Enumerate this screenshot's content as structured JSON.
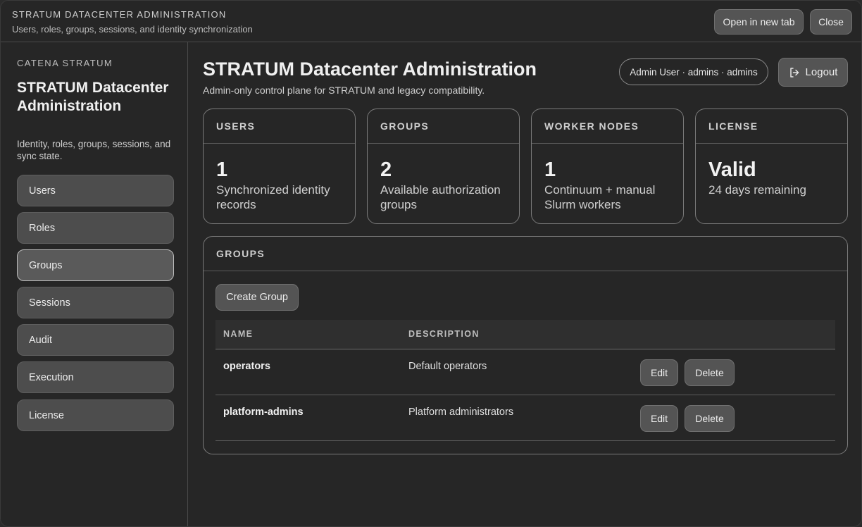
{
  "titlebar": {
    "title": "STRATUM DATACENTER ADMINISTRATION",
    "subtitle": "Users, roles, groups, sessions, and identity synchronization",
    "open_label": "Open in new tab",
    "close_label": "Close"
  },
  "sidebar": {
    "brand": "CATENA STRATUM",
    "title": "STRATUM Datacenter Administration",
    "description": "Identity, roles, groups, sessions, and sync state.",
    "items": [
      {
        "label": "Users"
      },
      {
        "label": "Roles"
      },
      {
        "label": "Groups"
      },
      {
        "label": "Sessions"
      },
      {
        "label": "Audit"
      },
      {
        "label": "Execution"
      },
      {
        "label": "License"
      }
    ],
    "active": "Groups"
  },
  "header": {
    "title": "STRATUM Datacenter Administration",
    "subtitle": "Admin-only control plane for STRATUM and legacy compatibility.",
    "user": "Admin User · admins · admins",
    "logout_label": "Logout",
    "logout_icon": "logout-icon"
  },
  "cards": [
    {
      "label": "USERS",
      "value": "1",
      "description": "Synchronized identity records"
    },
    {
      "label": "GROUPS",
      "value": "2",
      "description": "Available authorization groups"
    },
    {
      "label": "WORKER NODES",
      "value": "1",
      "description": "Continuum + manual Slurm workers"
    },
    {
      "label": "LICENSE",
      "value": "Valid",
      "description": "24 days remaining"
    }
  ],
  "groups": {
    "heading": "GROUPS",
    "create_label": "Create Group",
    "columns": {
      "name": "NAME",
      "description": "DESCRIPTION"
    },
    "rows": [
      {
        "name": "operators",
        "description": "Default operators",
        "edit_label": "Edit",
        "delete_label": "Delete"
      },
      {
        "name": "platform-admins",
        "description": "Platform administrators",
        "edit_label": "Edit",
        "delete_label": "Delete"
      }
    ]
  },
  "colors": {
    "background": "#262626",
    "button": "#545454",
    "border": "#7a7a7a"
  }
}
